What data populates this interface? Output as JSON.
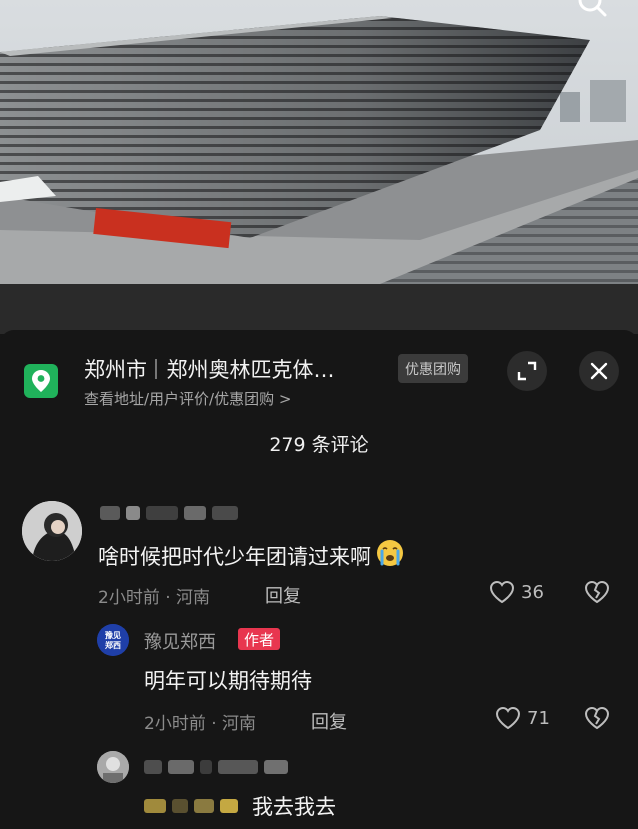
{
  "icons": {
    "search": "search-icon",
    "location": "location-pin-icon",
    "expand": "expand-icon",
    "close": "close-icon",
    "heart": "heart-icon",
    "broken_heart": "broken-heart-icon",
    "crying": "crying-face-icon"
  },
  "colors": {
    "accent_green": "#20b25b",
    "author_tag": "#e8364f",
    "sheet_bg": "#161616"
  },
  "location": {
    "city": "郑州市",
    "venue": "郑州奥林匹克体…",
    "subtitle": "查看地址/用户评价/优惠团购 >",
    "badge": "优惠团购"
  },
  "comments_header": {
    "title": "279 条评论"
  },
  "comments": [
    {
      "text": "啥时候把时代少年团请过来啊",
      "meta": "2小时前 · 河南",
      "reply": "回复",
      "likes": "36"
    },
    {
      "author": "豫见郑西",
      "author_tag": "作者",
      "avatar_text": "豫见郑西",
      "text": "明年可以期待期待",
      "meta": "2小时前 · 河南",
      "reply": "回复",
      "likes": "71"
    },
    {
      "text": "我去我去"
    }
  ]
}
